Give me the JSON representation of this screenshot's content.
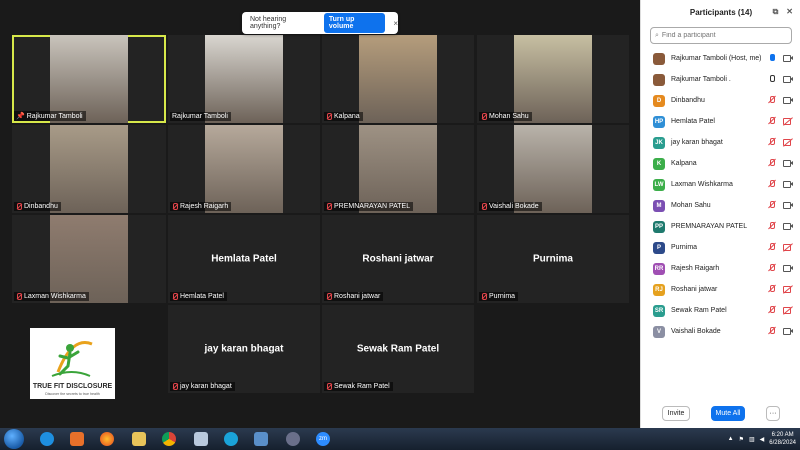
{
  "notification": {
    "text": "Not hearing anything?",
    "button": "Turn up volume",
    "close": "×"
  },
  "gallery": {
    "tiles": [
      {
        "name": "Rajkumar Tamboli",
        "video": true,
        "pinned": true,
        "active": true
      },
      {
        "name": "Rajkumar Tamboli",
        "video": true
      },
      {
        "name": "Kalpana",
        "video": true,
        "muted": true
      },
      {
        "name": "Mohan Sahu",
        "video": true,
        "muted": true
      },
      {
        "name": "Dinbandhu",
        "video": true,
        "muted": true
      },
      {
        "name": "Rajesh  Raigarh",
        "video": true,
        "muted": true
      },
      {
        "name": "PREMNARAYAN PATEL",
        "video": true,
        "muted": true
      },
      {
        "name": "Vaishali Bokade",
        "video": true,
        "muted": true
      },
      {
        "name": "Laxman Wishkarma",
        "video": true,
        "muted": true
      },
      {
        "name": "Hemlata Patel",
        "video": false,
        "muted": true
      },
      {
        "name": "Roshani jatwar",
        "video": false,
        "muted": true
      },
      {
        "name": "Purnima",
        "video": false,
        "muted": true
      },
      {
        "name": "jay karan bhagat",
        "video": false,
        "muted": true
      },
      {
        "name": "Sewak Ram Patel",
        "video": false,
        "muted": true
      }
    ],
    "logo": {
      "title": "TRUE FIT DISCLOSURE",
      "tagline": "Discover the secrets to true health"
    }
  },
  "participants": {
    "title": "Participants (14)",
    "search_placeholder": "Find a participant",
    "list": [
      {
        "name": "Rajkumar Tamboli (Host, me)",
        "initials": "",
        "color": "#8a5a3a",
        "photo": true,
        "mic": "on-active",
        "cam": "on"
      },
      {
        "name": "Rajkumar Tamboli .",
        "initials": "",
        "color": "#8a5a3a",
        "photo": true,
        "mic": "on",
        "cam": "on"
      },
      {
        "name": "Dinbandhu",
        "initials": "D",
        "color": "#e58a1f",
        "mic": "off",
        "cam": "on"
      },
      {
        "name": "Hemlata Patel",
        "initials": "HP",
        "color": "#2f8fd6",
        "mic": "off",
        "cam": "off"
      },
      {
        "name": "jay karan bhagat",
        "initials": "JK",
        "color": "#2a9d8f",
        "mic": "off",
        "cam": "off"
      },
      {
        "name": "Kalpana",
        "initials": "K",
        "color": "#3cae4a",
        "mic": "off",
        "cam": "on"
      },
      {
        "name": "Laxman Wishkarma",
        "initials": "LW",
        "color": "#3cae4a",
        "mic": "off",
        "cam": "on"
      },
      {
        "name": "Mohan Sahu",
        "initials": "M",
        "color": "#7b4fb3",
        "mic": "off",
        "cam": "on"
      },
      {
        "name": "PREMNARAYAN PATEL",
        "initials": "PP",
        "color": "#1f7a6e",
        "mic": "off",
        "cam": "on"
      },
      {
        "name": "Purnima",
        "initials": "P",
        "color": "#2d4a8a",
        "mic": "off",
        "cam": "off"
      },
      {
        "name": "Rajesh  Raigarh",
        "initials": "RR",
        "color": "#a04fb3",
        "mic": "off",
        "cam": "on"
      },
      {
        "name": "Roshani jatwar",
        "initials": "RJ",
        "color": "#e5a11f",
        "mic": "off",
        "cam": "off"
      },
      {
        "name": "Sewak Ram Patel",
        "initials": "SR",
        "color": "#2a9d8f",
        "mic": "off",
        "cam": "off"
      },
      {
        "name": "Vaishali Bokade",
        "initials": "V",
        "color": "#8b8fa3",
        "mic": "off",
        "cam": "on"
      }
    ],
    "invite": "Invite",
    "mute_all": "Mute All",
    "more": "···"
  },
  "taskbar": {
    "time": "6:20 AM",
    "date": "6/28/2024",
    "zoom_label": "zm"
  }
}
